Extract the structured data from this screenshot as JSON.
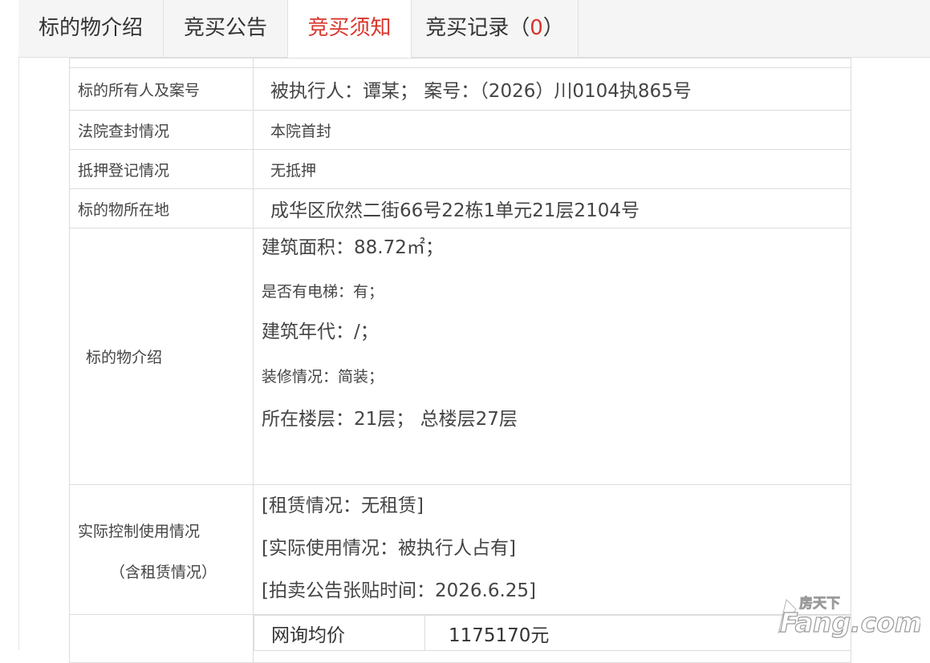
{
  "tabs": [
    {
      "label": "标的物介绍",
      "active": false
    },
    {
      "label": "竞买公告",
      "active": false
    },
    {
      "label": "竞买须知",
      "active": true
    },
    {
      "label": "竞买记录（",
      "count": "0",
      "suffix": "）",
      "active": false
    }
  ],
  "rows": {
    "owner": {
      "label": "标的所有人及案号",
      "value": "被执行人：谭某；  案号：（2026）川0104执865号"
    },
    "seal": {
      "label": "法院查封情况",
      "value": "本院首封"
    },
    "mortgage": {
      "label": "抵押登记情况",
      "value": "无抵押"
    },
    "location": {
      "label": "标的物所在地",
      "value": "成华区欣然二街66号22栋1单元21层2104号"
    },
    "intro": {
      "label": "标的物介绍",
      "lines": [
        "建筑面积：88.72㎡；",
        "是否有电梯：有；",
        "建筑年代：/；",
        "装修情况：简装；",
        "所在楼层：21层；  总楼层27层"
      ]
    },
    "usage": {
      "label": "实际控制使用情况",
      "sublabel": "（含租赁情况）",
      "lines": [
        "[租赁情况：无租赁]",
        "[实际使用情况：被执行人占有]",
        "[拍卖公告张贴时间：2026.6.25]"
      ]
    },
    "price": {
      "label": "网询均价",
      "value": "1175170元"
    }
  },
  "watermark": {
    "top": "房天下",
    "main": "Fang.com"
  },
  "colors": {
    "accent": "#d9352b",
    "border": "#dcdcdc",
    "tabbar": "#f5f5f5"
  }
}
